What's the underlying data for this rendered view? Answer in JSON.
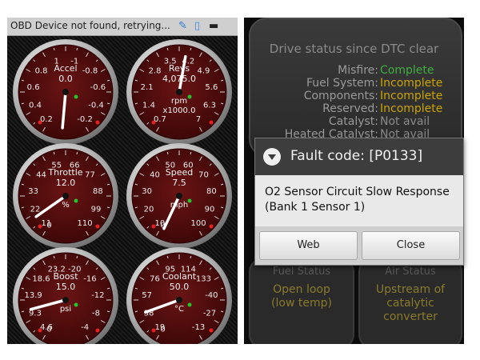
{
  "status_bar": {
    "message": "OBD Device not found, retrying...",
    "icons": [
      "bluetooth-icon",
      "phone-icon",
      "battery-icon"
    ]
  },
  "gauges": [
    {
      "name": "accel",
      "label": "Accel",
      "value_text": "0.0",
      "unit": "",
      "ticks": [
        "1",
        "-1",
        "0.8",
        "-0.8",
        "0.6",
        "-0.6",
        "0.4",
        "-0.4",
        "0.2",
        "-0.2"
      ],
      "needle_value_deg": 185
    },
    {
      "name": "revs",
      "label": "Revs",
      "value_text": "4,075.0",
      "unit": "rpm",
      "sub_unit": "x1000.0",
      "ticks": [
        "3.5",
        "4.2",
        "2.8",
        "4.9",
        "2.1",
        "5.6",
        "1.4",
        "6.3",
        "0.7",
        "7"
      ],
      "needle_value_deg": 10
    },
    {
      "name": "throttle",
      "label": "Throttle",
      "value_text": "12.0",
      "unit": "%",
      "ticks": [
        "55",
        "66",
        "44",
        "77",
        "33",
        "88",
        "22",
        "99",
        "11",
        "110",
        "0"
      ],
      "needle_value_deg": 235
    },
    {
      "name": "speed",
      "label": "Speed",
      "value_text": "7.5",
      "unit": "mph",
      "ticks": [
        "50",
        "60",
        "40",
        "70",
        "30",
        "80",
        "20",
        "90",
        "10",
        "100",
        "0"
      ],
      "needle_value_deg": 205
    },
    {
      "name": "boost",
      "label": "Boost",
      "value_text": "15.0",
      "unit": "psi",
      "ticks": [
        "23.2",
        "-20",
        "18.6",
        "-16",
        "13.9",
        "-12",
        "9.3",
        "-8",
        "4.6",
        "-4",
        "0"
      ],
      "needle_value_deg": 255
    },
    {
      "name": "coolant",
      "label": "Coolant",
      "value_text": "50.0",
      "unit": "°C",
      "ticks": [
        "95",
        "114",
        "76",
        "133",
        "57",
        "-40",
        "38",
        "-27",
        "19",
        "-13",
        "0"
      ],
      "needle_value_deg": 250
    }
  ],
  "drive_status": {
    "title": "Drive status since DTC clear",
    "rows": [
      {
        "key": "Misfire:",
        "value": "Complete",
        "color": "#3fae3f"
      },
      {
        "key": "Fuel System:",
        "value": "Incomplete",
        "color": "#c9a400"
      },
      {
        "key": "Components:",
        "value": "Incomplete",
        "color": "#c9a400"
      },
      {
        "key": "Reserved:",
        "value": "Incomplete",
        "color": "#c9a400"
      },
      {
        "key": "Catalyst:",
        "value": "Not avail",
        "color": "#8a8a8a"
      },
      {
        "key": "Heated Catalyst:",
        "value": "Not avail",
        "color": "#8a8a8a"
      }
    ]
  },
  "fuel_status": {
    "title": "Fuel Status",
    "value_line1": "Open loop",
    "value_line2": "(low temp)"
  },
  "air_status": {
    "title": "Air Status",
    "value_line1": "Upstream of",
    "value_line2": "catalytic",
    "value_line3": "converter"
  },
  "dialog": {
    "title": "Fault code: [P0133]",
    "message": "O2 Sensor Circuit Slow Response (Bank 1 Sensor 1)",
    "web_label": "Web",
    "close_label": "Close"
  }
}
